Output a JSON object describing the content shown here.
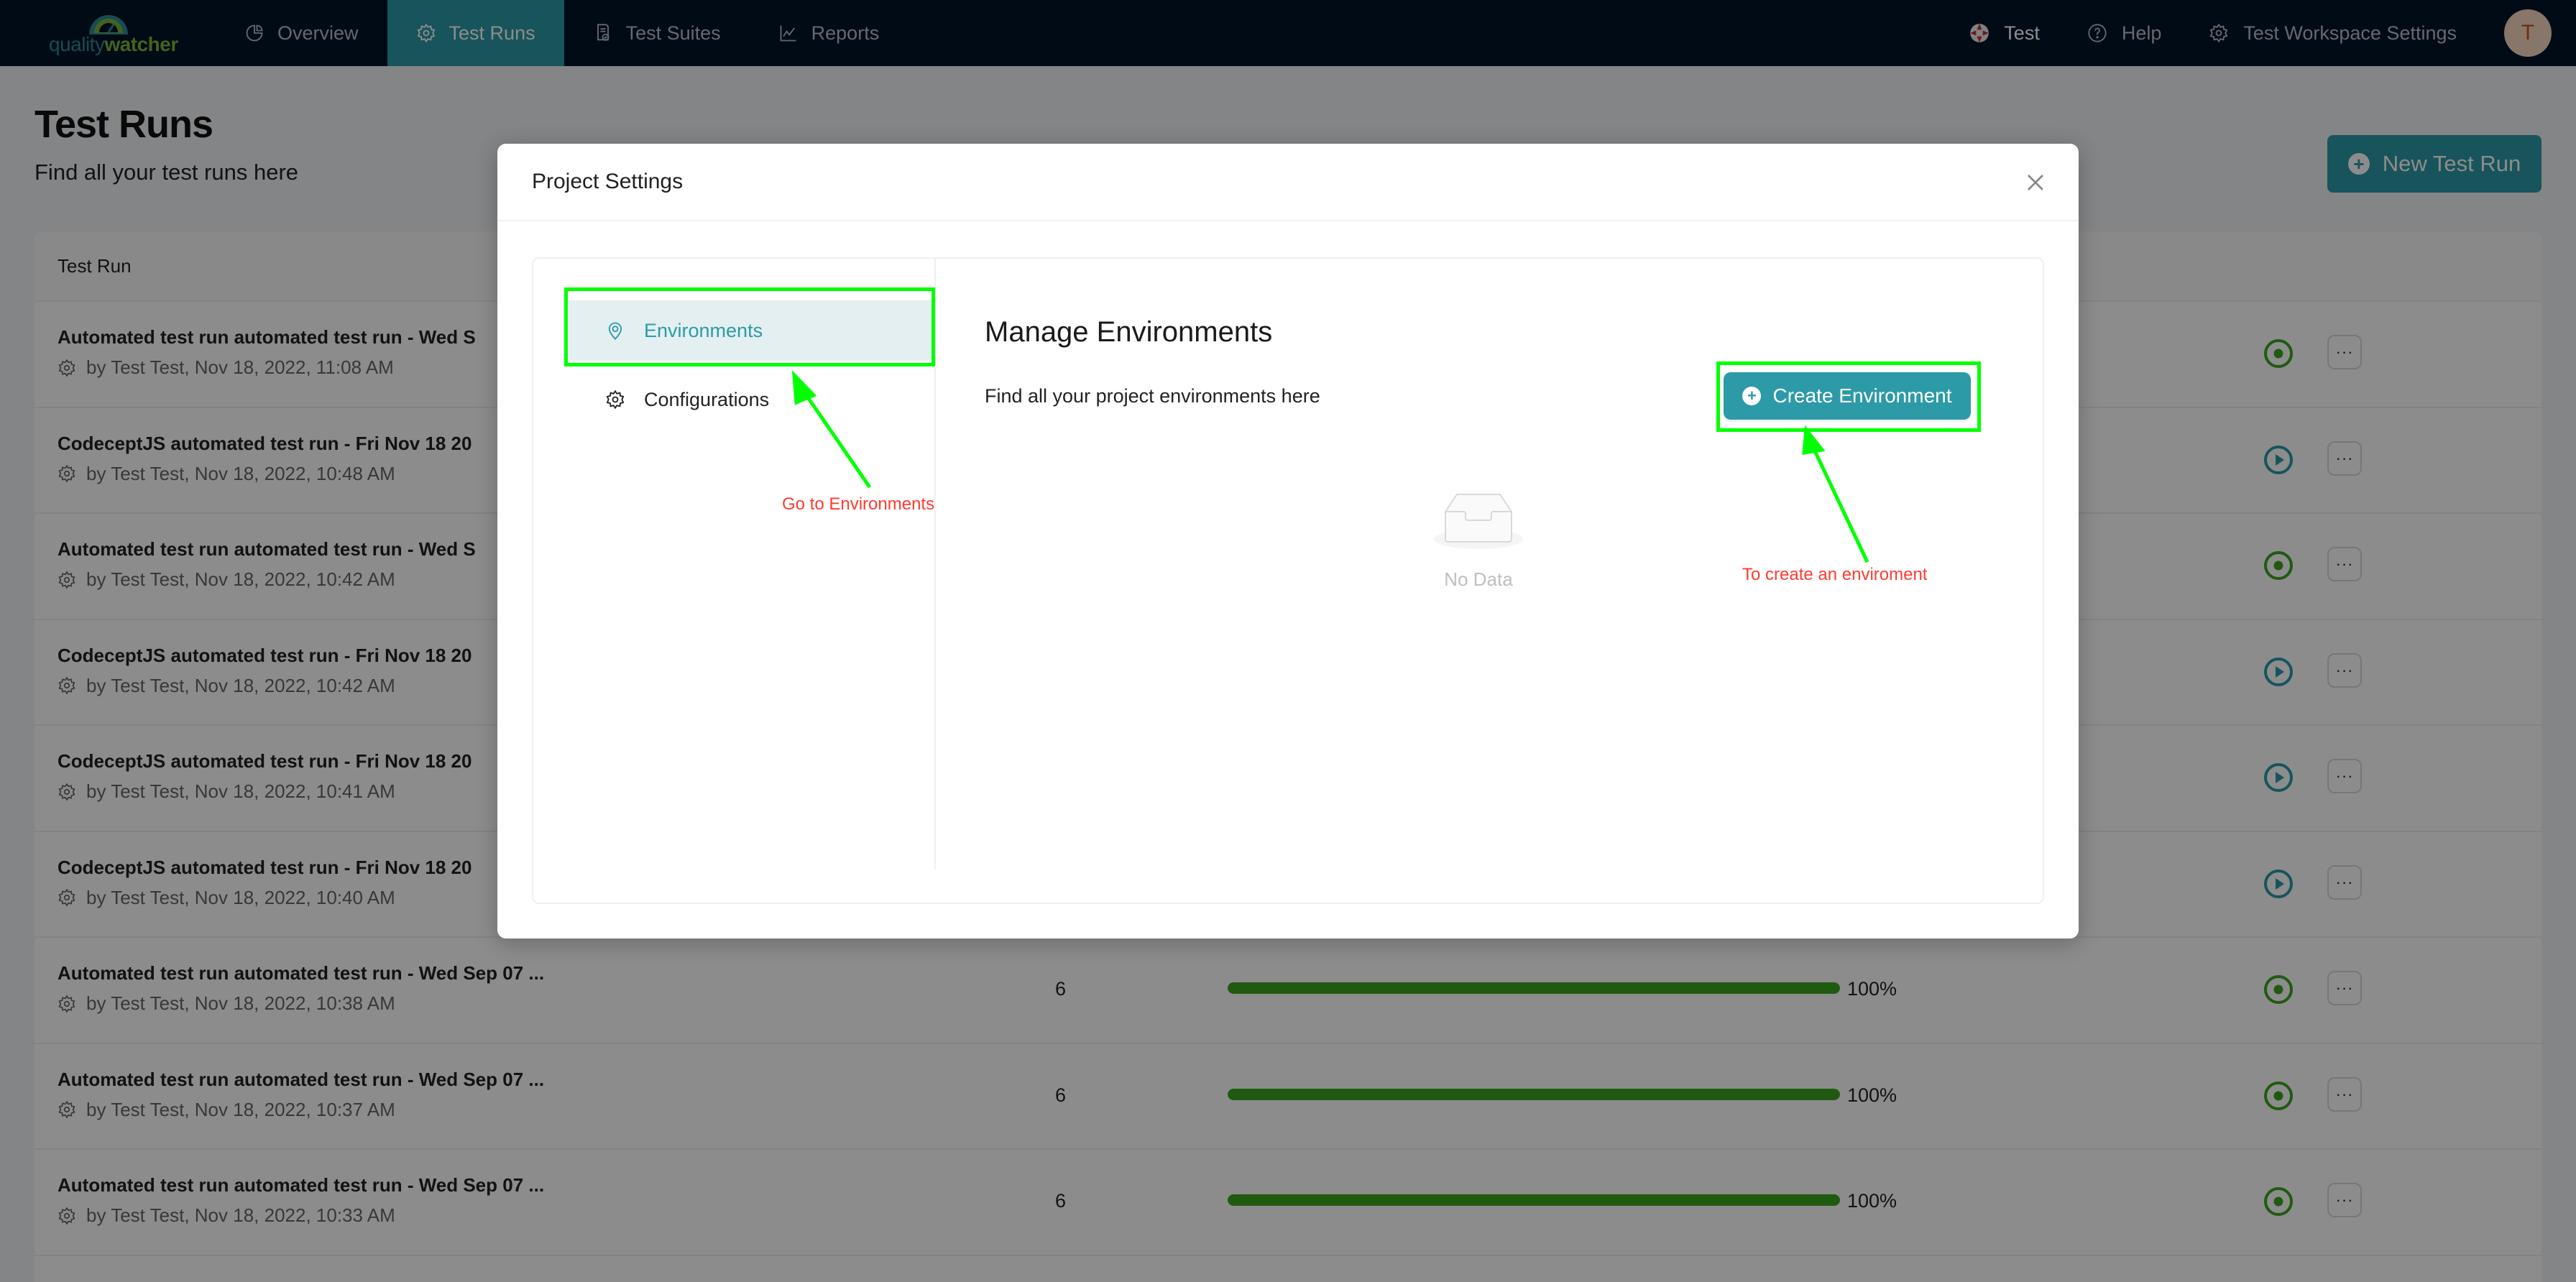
{
  "app": {
    "logo": {
      "part1": "quality",
      "part2": "watcher"
    },
    "nav": {
      "items": [
        {
          "label": "Overview",
          "icon": "pie-chart-icon",
          "active": false
        },
        {
          "label": "Test Runs",
          "icon": "gear-icon",
          "active": true
        },
        {
          "label": "Test Suites",
          "icon": "file-check-icon",
          "active": false
        },
        {
          "label": "Reports",
          "icon": "line-chart-icon",
          "active": false
        }
      ],
      "right": {
        "workspace": "Test",
        "help": "Help",
        "settings": "Test Workspace Settings",
        "avatar_initial": "T"
      }
    }
  },
  "page": {
    "title": "Test Runs",
    "subtitle": "Find all your test runs here",
    "new_run_label": "New Test Run",
    "table": {
      "header": "Test Run",
      "rows": [
        {
          "title": "Automated test run automated test run - Wed S",
          "meta": "by Test Test, Nov 18, 2022, 11:08 AM",
          "count": "",
          "progress": null,
          "status": "passed"
        },
        {
          "title": "CodeceptJS automated test run - Fri Nov 18 20",
          "meta": "by Test Test, Nov 18, 2022, 10:48 AM",
          "count": "",
          "progress": null,
          "status": "run"
        },
        {
          "title": "Automated test run automated test run - Wed S",
          "meta": "by Test Test, Nov 18, 2022, 10:42 AM",
          "count": "",
          "progress": null,
          "status": "passed"
        },
        {
          "title": "CodeceptJS automated test run - Fri Nov 18 20",
          "meta": "by Test Test, Nov 18, 2022, 10:42 AM",
          "count": "",
          "progress": null,
          "status": "run"
        },
        {
          "title": "CodeceptJS automated test run - Fri Nov 18 20",
          "meta": "by Test Test, Nov 18, 2022, 10:41 AM",
          "count": "",
          "progress": null,
          "status": "run"
        },
        {
          "title": "CodeceptJS automated test run - Fri Nov 18 20",
          "meta": "by Test Test, Nov 18, 2022, 10:40 AM",
          "count": "",
          "progress": null,
          "status": "run"
        },
        {
          "title": "Automated test run automated test run - Wed Sep 07 ...",
          "meta": "by Test Test, Nov 18, 2022, 10:38 AM",
          "count": "6",
          "progress": 100,
          "progress_label": "100%",
          "status": "passed"
        },
        {
          "title": "Automated test run automated test run - Wed Sep 07 ...",
          "meta": "by Test Test, Nov 18, 2022, 10:37 AM",
          "count": "6",
          "progress": 100,
          "progress_label": "100%",
          "status": "passed"
        },
        {
          "title": "Automated test run automated test run - Wed Sep 07 ...",
          "meta": "by Test Test, Nov 18, 2022, 10:33 AM",
          "count": "6",
          "progress": 100,
          "progress_label": "100%",
          "status": "passed"
        }
      ],
      "more_label": "···"
    }
  },
  "modal": {
    "title": "Project Settings",
    "menu": [
      {
        "label": "Environments",
        "icon": "location-pin-icon",
        "active": true
      },
      {
        "label": "Configurations",
        "icon": "gear-icon",
        "active": false
      }
    ],
    "content": {
      "title": "Manage Environments",
      "subtitle": "Find all your project environments here",
      "create_label": "Create Environment",
      "empty_text": "No Data"
    }
  },
  "annotations": {
    "go_to_env": "Go to Environments",
    "create_env": "To create an enviroment",
    "highlight_color": "#00ff00",
    "text_color": "#ff3b30"
  },
  "colors": {
    "brand": "#2d9aa8",
    "nav_bg": "#001529",
    "success": "#3ba51f"
  }
}
